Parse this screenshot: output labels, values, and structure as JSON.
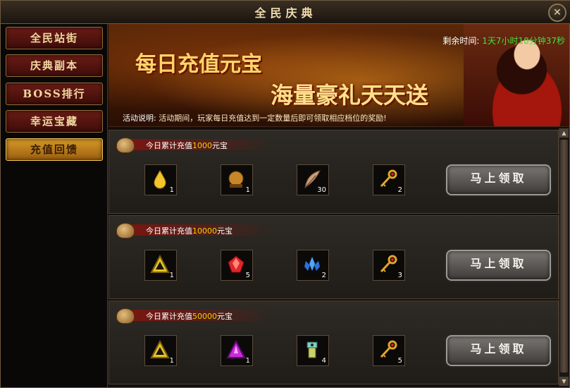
{
  "window": {
    "title": "全民庆典",
    "close_label": "✕"
  },
  "sidebar": {
    "items": [
      {
        "label": "全民站街",
        "active": false
      },
      {
        "label": "庆典副本",
        "active": false
      },
      {
        "label": "BOSS排行",
        "active": false
      },
      {
        "label": "幸运宝藏",
        "active": false
      },
      {
        "label": "充值回馈",
        "active": true
      }
    ]
  },
  "banner": {
    "line1": "每日充值元宝",
    "line2": "海量豪礼天天送",
    "remaining_label": "剩余时间:",
    "remaining_value": "1天7小时18分钟37秒",
    "desc_label": "活动说明:",
    "desc_text": "活动期间，玩家每日充值达到一定数量后即可领取相应档位的奖励!"
  },
  "tiers": [
    {
      "prefix": "今日累计充值",
      "amount": "1000",
      "suffix": "元宝",
      "claim_label": "马上领取",
      "rewards": [
        {
          "icon": "yellow-drop-icon",
          "qty": "1"
        },
        {
          "icon": "golden-orb-icon",
          "qty": "1"
        },
        {
          "icon": "feather-icon",
          "qty": "30"
        },
        {
          "icon": "gold-key-icon",
          "qty": "2"
        }
      ]
    },
    {
      "prefix": "今日累计充值",
      "amount": "10000",
      "suffix": "元宝",
      "claim_label": "马上领取",
      "rewards": [
        {
          "icon": "gold-triangle-icon",
          "qty": "1"
        },
        {
          "icon": "red-gem-icon",
          "qty": "5"
        },
        {
          "icon": "blue-crystal-icon",
          "qty": "2"
        },
        {
          "icon": "gold-key-icon",
          "qty": "3"
        }
      ]
    },
    {
      "prefix": "今日累计充值",
      "amount": "50000",
      "suffix": "元宝",
      "claim_label": "马上领取",
      "rewards": [
        {
          "icon": "gold-triangle-icon",
          "qty": "1"
        },
        {
          "icon": "purple-triangle-icon",
          "qty": "1"
        },
        {
          "icon": "mech-part-icon",
          "qty": "4"
        },
        {
          "icon": "gold-key-icon",
          "qty": "5"
        }
      ]
    }
  ],
  "colors": {
    "accent_gold": "#ffcc00",
    "remaining_green": "#3fe03f",
    "sidebar_red": "#6a1b14",
    "active_gold": "#d79a27"
  }
}
